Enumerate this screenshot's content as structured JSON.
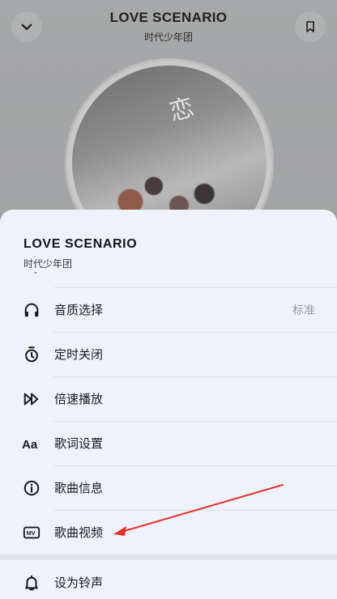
{
  "player": {
    "song_title": "LOVE SCENARIO",
    "artist": "时代少年团",
    "cover_text": "恋"
  },
  "sheet": {
    "song_title": "LOVE SCENARIO",
    "artist": "时代少年团",
    "items": [
      {
        "label": "音质选择",
        "value": "标准",
        "icon": "headphones-icon"
      },
      {
        "label": "定时关闭",
        "icon": "timer-icon"
      },
      {
        "label": "倍速播放",
        "icon": "speed-icon"
      },
      {
        "label": "歌词设置",
        "icon": "font-icon"
      },
      {
        "label": "歌曲信息",
        "icon": "info-icon"
      },
      {
        "label": "歌曲视频",
        "icon": "mv-icon"
      },
      {
        "label": "设为铃声",
        "icon": "bell-icon"
      }
    ]
  },
  "colors": {
    "sheet_background": "#eef3fb",
    "annotation_arrow": "#e8302a",
    "secondary_text": "#9b9b9b"
  }
}
